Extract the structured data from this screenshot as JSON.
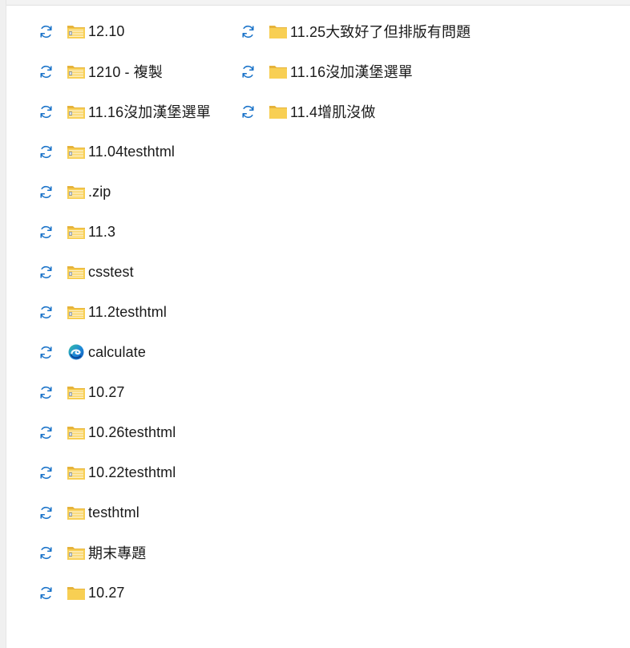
{
  "colors": {
    "sync_blue": "#1a73c9",
    "folder_yellow": "#f8cf53",
    "folder_dark": "#e6b33b",
    "zip_stripe": "#9aa4ad"
  },
  "icons": {
    "sync": "sync-status-icon",
    "zip": "compressed-folder-icon",
    "folder": "folder-icon",
    "edge": "edge-browser-icon"
  },
  "files": [
    {
      "name": "12.10",
      "type": "zip"
    },
    {
      "name": "1210 - 複製",
      "type": "zip"
    },
    {
      "name": "11.16沒加漢堡選單",
      "type": "zip"
    },
    {
      "name": "11.04testhtml",
      "type": "zip"
    },
    {
      "name": ".zip",
      "type": "zip"
    },
    {
      "name": "11.3",
      "type": "zip"
    },
    {
      "name": "csstest",
      "type": "zip"
    },
    {
      "name": "11.2testhtml",
      "type": "zip"
    },
    {
      "name": "calculate",
      "type": "edge"
    },
    {
      "name": "10.27",
      "type": "zip"
    },
    {
      "name": "10.26testhtml",
      "type": "zip"
    },
    {
      "name": "10.22testhtml",
      "type": "zip"
    },
    {
      "name": "testhtml",
      "type": "zip"
    },
    {
      "name": "期末專題",
      "type": "zip"
    },
    {
      "name": "10.27",
      "type": "folder"
    },
    {
      "name": "11.25大致好了但排版有問題",
      "type": "folder"
    },
    {
      "name": "11.16沒加漢堡選單",
      "type": "folder"
    },
    {
      "name": "11.4增肌沒做",
      "type": "folder"
    }
  ]
}
